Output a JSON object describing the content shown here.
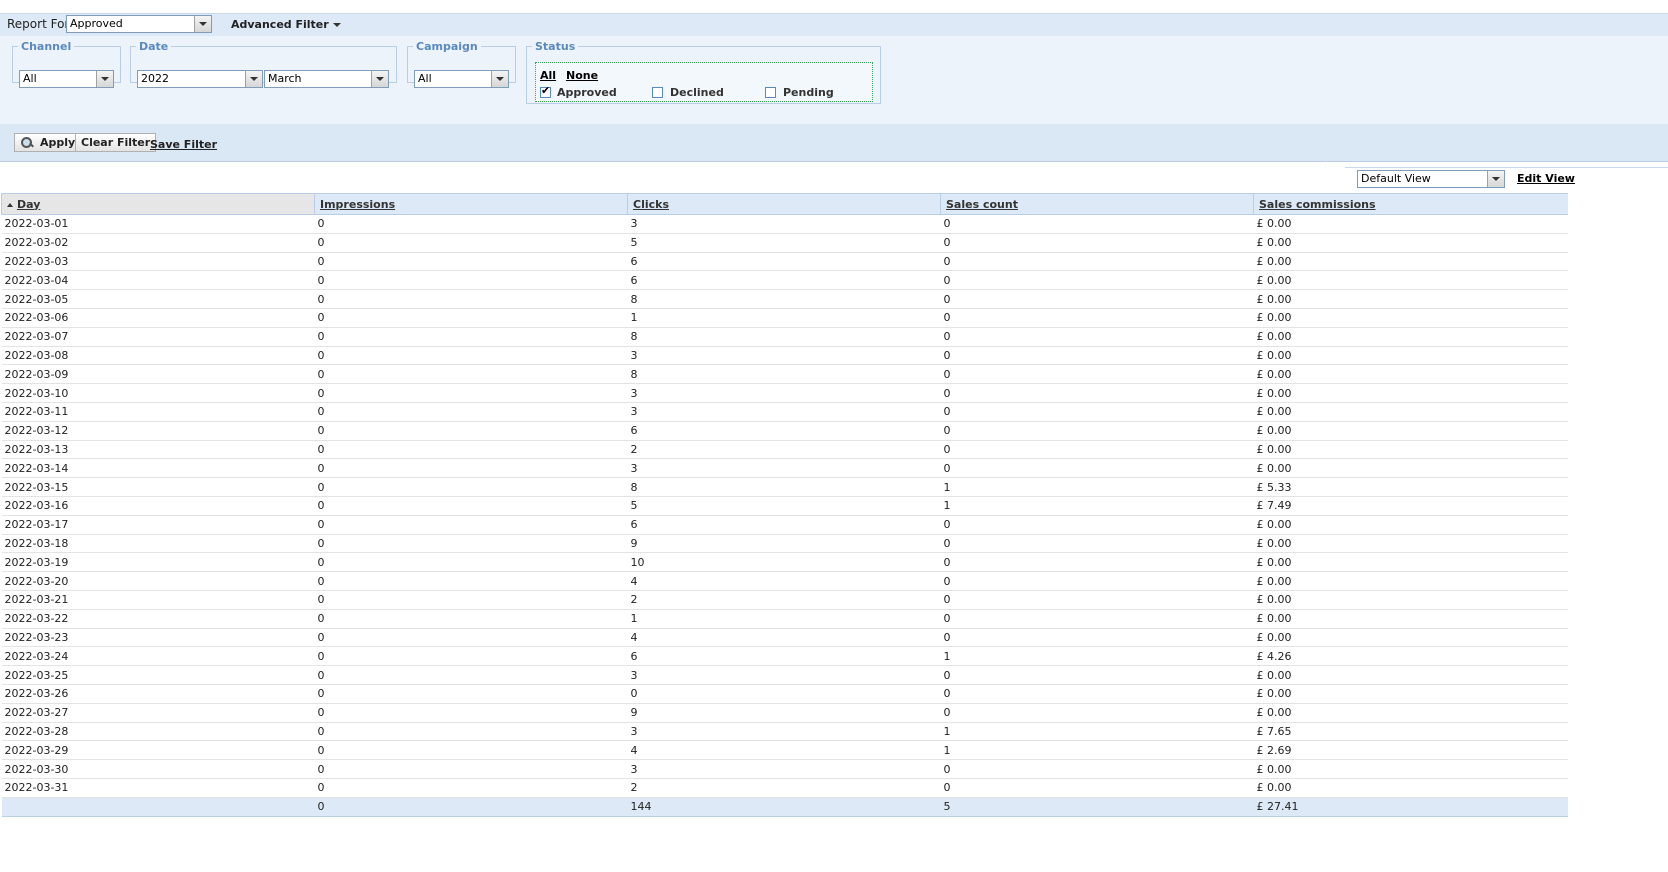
{
  "report_for": {
    "label": "Report For",
    "value": "Approved"
  },
  "advanced_filter": {
    "label": "Advanced Filter"
  },
  "filters": {
    "channel": {
      "legend": "Channel",
      "value": "All"
    },
    "date": {
      "legend": "Date",
      "year": "2022",
      "month": "March"
    },
    "campaign": {
      "legend": "Campaign",
      "value": "All"
    },
    "status": {
      "legend": "Status",
      "all_label": "All",
      "none_label": "None",
      "options": [
        {
          "label": "Approved",
          "checked": true
        },
        {
          "label": "Declined",
          "checked": false
        },
        {
          "label": "Pending",
          "checked": false
        }
      ]
    }
  },
  "buttons": {
    "apply": "Apply",
    "clear_filter": "Clear Filter",
    "save_filter": "Save Filter"
  },
  "view": {
    "selected": "Default View",
    "edit_label": "Edit View"
  },
  "table": {
    "columns": [
      "Day",
      "Impressions",
      "Clicks",
      "Sales count",
      "Sales commissions"
    ],
    "sorted_column": "Day",
    "rows": [
      [
        "2022-03-01",
        "0",
        "3",
        "0",
        "£ 0.00"
      ],
      [
        "2022-03-02",
        "0",
        "5",
        "0",
        "£ 0.00"
      ],
      [
        "2022-03-03",
        "0",
        "6",
        "0",
        "£ 0.00"
      ],
      [
        "2022-03-04",
        "0",
        "6",
        "0",
        "£ 0.00"
      ],
      [
        "2022-03-05",
        "0",
        "8",
        "0",
        "£ 0.00"
      ],
      [
        "2022-03-06",
        "0",
        "1",
        "0",
        "£ 0.00"
      ],
      [
        "2022-03-07",
        "0",
        "8",
        "0",
        "£ 0.00"
      ],
      [
        "2022-03-08",
        "0",
        "3",
        "0",
        "£ 0.00"
      ],
      [
        "2022-03-09",
        "0",
        "8",
        "0",
        "£ 0.00"
      ],
      [
        "2022-03-10",
        "0",
        "3",
        "0",
        "£ 0.00"
      ],
      [
        "2022-03-11",
        "0",
        "3",
        "0",
        "£ 0.00"
      ],
      [
        "2022-03-12",
        "0",
        "6",
        "0",
        "£ 0.00"
      ],
      [
        "2022-03-13",
        "0",
        "2",
        "0",
        "£ 0.00"
      ],
      [
        "2022-03-14",
        "0",
        "3",
        "0",
        "£ 0.00"
      ],
      [
        "2022-03-15",
        "0",
        "8",
        "1",
        "£ 5.33"
      ],
      [
        "2022-03-16",
        "0",
        "5",
        "1",
        "£ 7.49"
      ],
      [
        "2022-03-17",
        "0",
        "6",
        "0",
        "£ 0.00"
      ],
      [
        "2022-03-18",
        "0",
        "9",
        "0",
        "£ 0.00"
      ],
      [
        "2022-03-19",
        "0",
        "10",
        "0",
        "£ 0.00"
      ],
      [
        "2022-03-20",
        "0",
        "4",
        "0",
        "£ 0.00"
      ],
      [
        "2022-03-21",
        "0",
        "2",
        "0",
        "£ 0.00"
      ],
      [
        "2022-03-22",
        "0",
        "1",
        "0",
        "£ 0.00"
      ],
      [
        "2022-03-23",
        "0",
        "4",
        "0",
        "£ 0.00"
      ],
      [
        "2022-03-24",
        "0",
        "6",
        "1",
        "£ 4.26"
      ],
      [
        "2022-03-25",
        "0",
        "3",
        "0",
        "£ 0.00"
      ],
      [
        "2022-03-26",
        "0",
        "0",
        "0",
        "£ 0.00"
      ],
      [
        "2022-03-27",
        "0",
        "9",
        "0",
        "£ 0.00"
      ],
      [
        "2022-03-28",
        "0",
        "3",
        "1",
        "£ 7.65"
      ],
      [
        "2022-03-29",
        "0",
        "4",
        "1",
        "£ 2.69"
      ],
      [
        "2022-03-30",
        "0",
        "3",
        "0",
        "£ 0.00"
      ],
      [
        "2022-03-31",
        "0",
        "2",
        "0",
        "£ 0.00"
      ]
    ],
    "totals": [
      "",
      "0",
      "144",
      "5",
      "£ 27.41"
    ]
  }
}
